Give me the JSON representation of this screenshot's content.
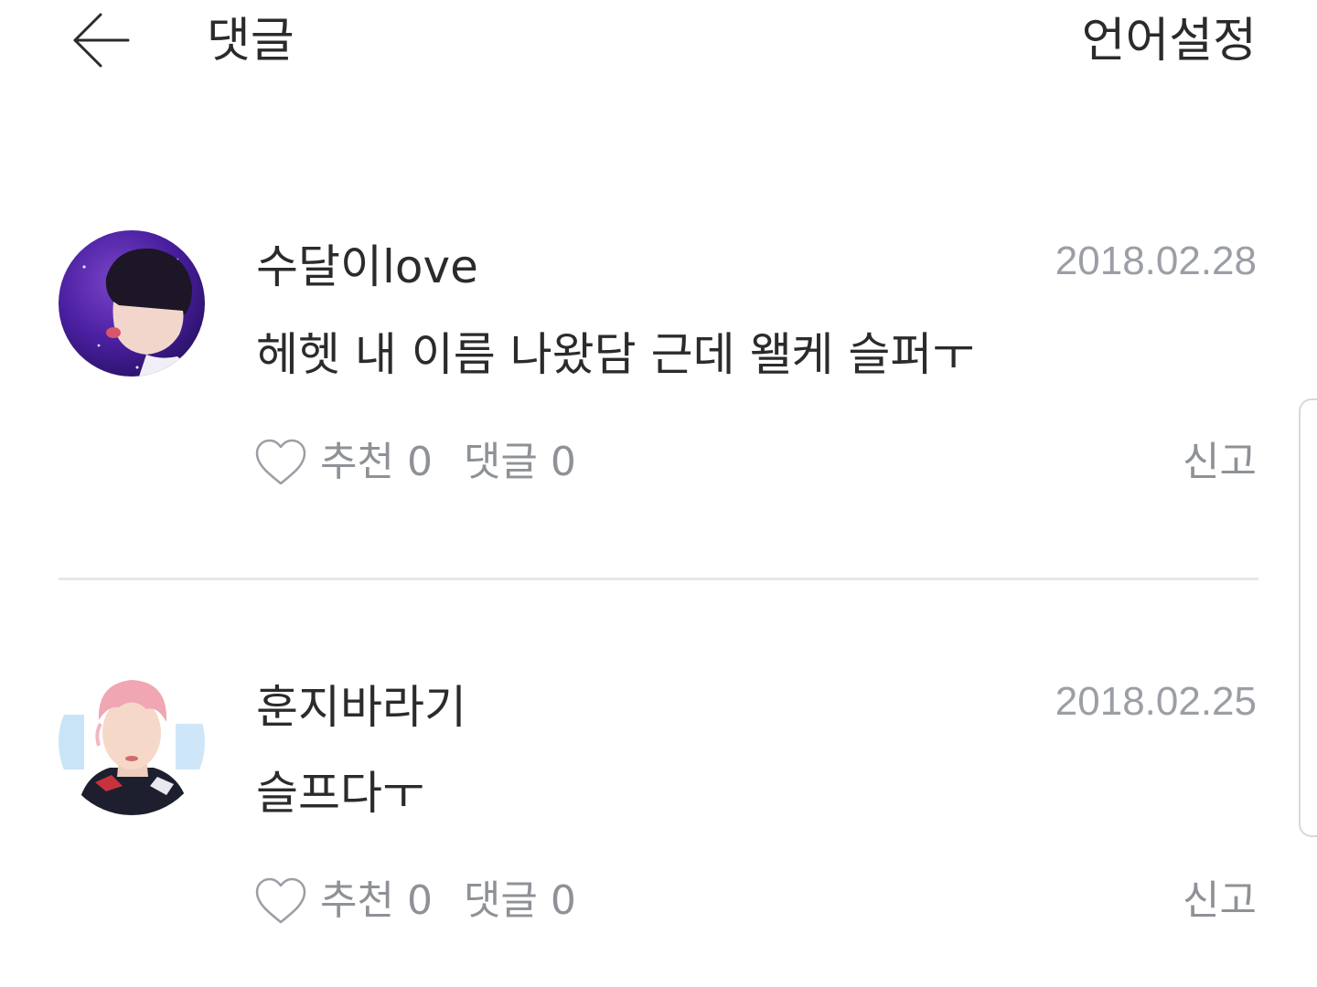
{
  "header": {
    "title": "댓글",
    "language_label": "언어설정"
  },
  "comments": [
    {
      "username": "수달이love",
      "date": "2018.02.28",
      "text": "헤헷 내 이름 나왔담 근데 왤케 슬퍼ㅜ",
      "like_label": "추천 0",
      "reply_label": "댓글 0",
      "report_label": "신고"
    },
    {
      "username": "훈지바라기",
      "date": "2018.02.25",
      "text": "슬프다ㅜ",
      "like_label": "추천 0",
      "reply_label": "댓글 0",
      "report_label": "신고"
    }
  ],
  "icons": {
    "back": "arrow-left-icon",
    "like": "heart-outline-icon"
  },
  "colors": {
    "text_primary": "#2b2b2b",
    "text_secondary": "#9b9fa5",
    "divider": "#e6e7e8"
  }
}
